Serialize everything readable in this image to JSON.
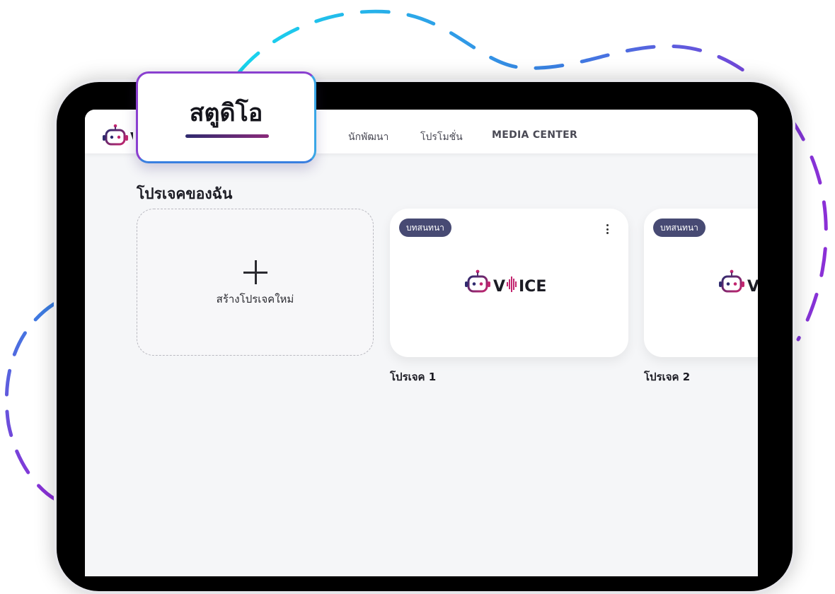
{
  "studio_tab": {
    "label": "สตูดิโอ"
  },
  "navbar": {
    "logo_icon": "robot-head-icon",
    "links": [
      "นักพัฒนา",
      "โปรโมชั่น",
      "MEDIA CENTER"
    ]
  },
  "main": {
    "section_title": "โปรเจคของฉัน",
    "create_card": {
      "icon": "plus-icon",
      "label": "สร้างโปรเจคใหม่"
    },
    "projects": [
      {
        "badge": "บทสนทนา",
        "logo_text": "V  ICE",
        "name": "โปรเจค 1"
      },
      {
        "badge": "บทสนทนา",
        "logo_text": "V",
        "name": "โปรเจค 2"
      }
    ]
  },
  "colors": {
    "accent_purple": "#8a3fd0",
    "accent_cyan": "#22c8e8",
    "badge_bg": "#474a73",
    "brand_gradient_start": "#2f2a6e",
    "brand_gradient_end": "#c2266f"
  }
}
